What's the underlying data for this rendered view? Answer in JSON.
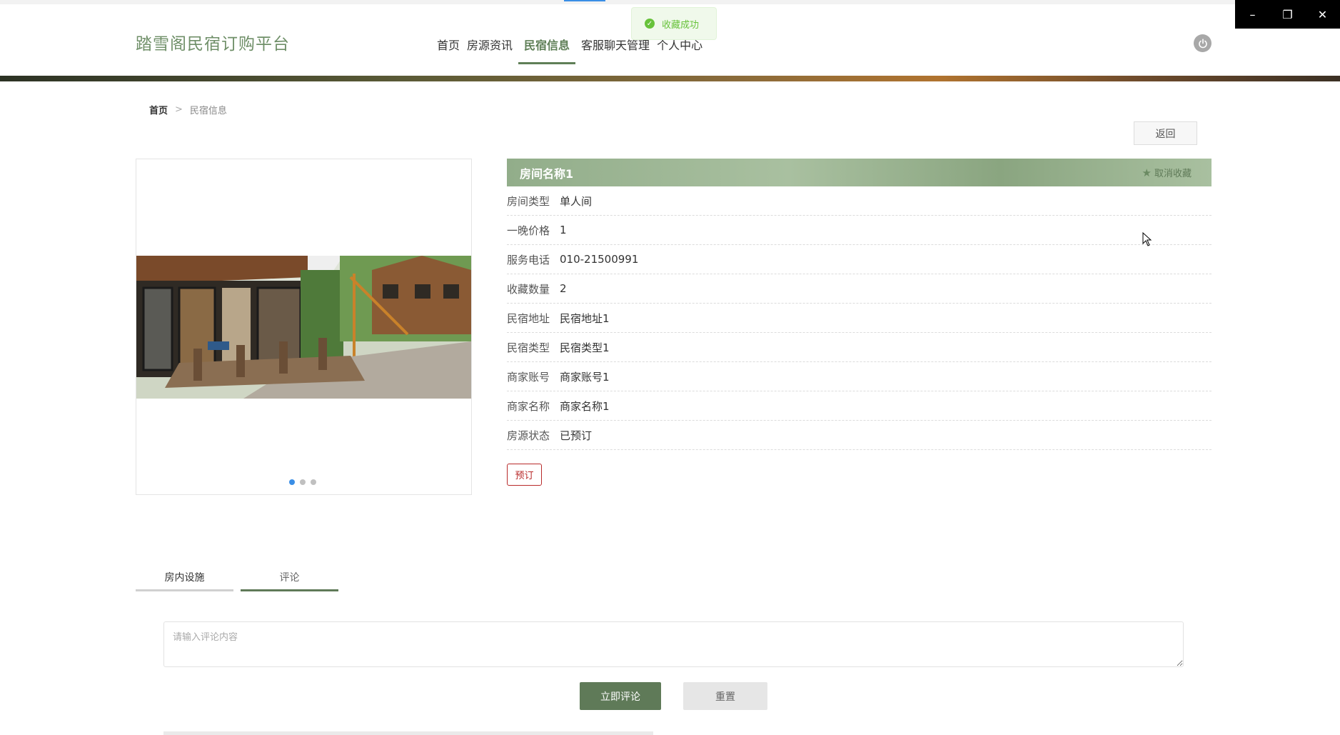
{
  "header": {
    "logo": "踏雪阁民宿订购平台",
    "nav": [
      "首页",
      "房源资讯",
      "民宿信息",
      "客服聊天管理",
      "个人中心"
    ],
    "active_nav_index": 2
  },
  "toast": {
    "text": "收藏成功",
    "icon": "check-circle-icon"
  },
  "window_controls": {
    "minimize": "–",
    "restore": "❐",
    "close": "✕"
  },
  "breadcrumb": {
    "home": "首页",
    "separator": ">",
    "current": "民宿信息"
  },
  "actions": {
    "back": "返回",
    "book": "预订",
    "submit_comment": "立即评论",
    "reset": "重置"
  },
  "carousel": {
    "dot_count": 3,
    "active_index": 0
  },
  "detail": {
    "title": "房间名称1",
    "favorite_label": "取消收藏",
    "rows": [
      {
        "label": "房间类型",
        "value": "单人间"
      },
      {
        "label": "一晚价格",
        "value": "1"
      },
      {
        "label": "服务电话",
        "value": "010-21500991"
      },
      {
        "label": "收藏数量",
        "value": "2"
      },
      {
        "label": "民宿地址",
        "value": "民宿地址1"
      },
      {
        "label": "民宿类型",
        "value": "民宿类型1"
      },
      {
        "label": "商家账号",
        "value": "商家账号1"
      },
      {
        "label": "商家名称",
        "value": "商家名称1"
      },
      {
        "label": "房源状态",
        "value": "已预订"
      }
    ]
  },
  "tabs": [
    {
      "label": "房内设施",
      "active": false
    },
    {
      "label": "评论",
      "active": true
    }
  ],
  "comment": {
    "placeholder": "请输入评论内容",
    "value": ""
  },
  "colors": {
    "accent": "#5f7a58",
    "title_bar": "#92ad8a",
    "book_red": "#b82a2a",
    "toast_green": "#67c23a"
  }
}
